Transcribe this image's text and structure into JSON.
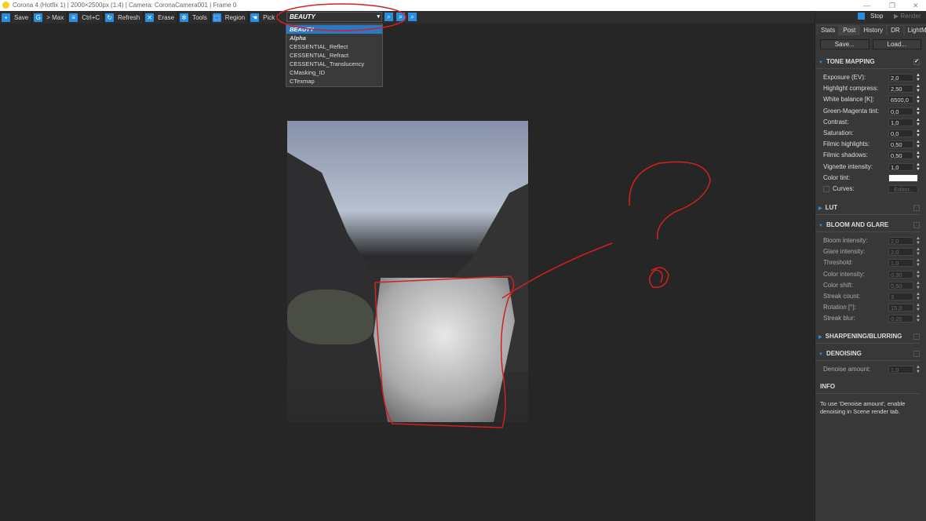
{
  "window": {
    "title": "Corona 4 (Hotfix 1) | 2000×2500px (1:4) | Camera: CoronaCamera001 | Frame 0"
  },
  "toolbar": {
    "items": [
      {
        "label": "Save",
        "icon": "save-icon"
      },
      {
        "label": "> Max",
        "icon": "max-icon"
      },
      {
        "label": "Ctrl+C",
        "icon": "copy-icon"
      },
      {
        "label": "Refresh",
        "icon": "refresh-icon"
      },
      {
        "label": "Erase",
        "icon": "erase-icon"
      },
      {
        "label": "Tools",
        "icon": "gear-icon"
      },
      {
        "label": "Region",
        "icon": "region-icon"
      },
      {
        "label": "Pick",
        "icon": "pick-icon"
      }
    ],
    "pass_selected": "BEAUTY"
  },
  "pass_menu": [
    "BEAUTY",
    "Alpha",
    "CESSENTIAL_Reflect",
    "CESSENTIAL_Refract",
    "CESSENTIAL_Translucency",
    "CMasking_ID",
    "CTexmap"
  ],
  "panel": {
    "stop": "Stop",
    "render": "Render",
    "tabs": [
      "Stats",
      "Post",
      "History",
      "DR",
      "LightMix"
    ],
    "active_tab": "Post",
    "save": "Save...",
    "load": "Load...",
    "tone": {
      "title": "TONE MAPPING",
      "rows": [
        {
          "label": "Exposure (EV):",
          "value": "2,0"
        },
        {
          "label": "Highlight compress:",
          "value": "2,50"
        },
        {
          "label": "White balance [K]:",
          "value": "6500,0"
        },
        {
          "label": "Green-Magenta tint:",
          "value": "0,0"
        },
        {
          "label": "Contrast:",
          "value": "1,0"
        },
        {
          "label": "Saturation:",
          "value": "0,0"
        },
        {
          "label": "Filmic highlights:",
          "value": "0,50"
        },
        {
          "label": "Filmic shadows:",
          "value": "0,50"
        },
        {
          "label": "Vignette intensity:",
          "value": "1,0"
        }
      ],
      "color_tint": "Color tint:",
      "curves": "Curves:",
      "editor": "Editor..."
    },
    "lut": "LUT",
    "bloom": {
      "title": "BLOOM AND GLARE",
      "rows": [
        {
          "label": "Bloom intensity:",
          "value": "2,0"
        },
        {
          "label": "Glare intensity:",
          "value": "2,0"
        },
        {
          "label": "Threshold:",
          "value": "1,0"
        },
        {
          "label": "Color intensity:",
          "value": "0,30"
        },
        {
          "label": "Color shift:",
          "value": "0,50"
        },
        {
          "label": "Streak count:",
          "value": "3"
        },
        {
          "label": "Rotation [°]:",
          "value": "15,0"
        },
        {
          "label": "Streak blur:",
          "value": "0,20"
        }
      ]
    },
    "sharpen": "SHARPENING/BLURRING",
    "denoise": {
      "title": "DENOISING",
      "label": "Denoise amount:",
      "value": "1,0"
    },
    "info": {
      "title": "INFO",
      "text": "To use 'Denoise amount', enable denoising in Scene render tab."
    }
  },
  "colors": {
    "accent": "#2a8ee0",
    "annotation": "#d42020"
  }
}
